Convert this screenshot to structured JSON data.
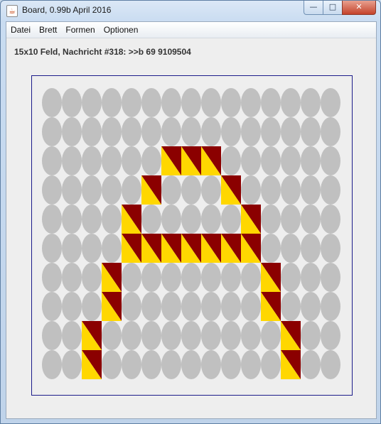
{
  "window": {
    "title": "Board, 0.99b April 2016",
    "icon": "java-cup-icon",
    "controls": {
      "minimize": "—",
      "maximize": "□",
      "close": "✕"
    }
  },
  "menu": [
    "Datei",
    "Brett",
    "Formen",
    "Optionen"
  ],
  "status_text": "15x10 Feld, Nachricht #318: >>b 69 9109504",
  "board": {
    "cols": 15,
    "rows": 10,
    "empty_color": "#c0c0c0",
    "piece_colors": {
      "dark": "#8b0000",
      "light": "#ffd700"
    },
    "border_color": "#1b1b8a",
    "filled": [
      [
        2,
        6
      ],
      [
        2,
        7
      ],
      [
        2,
        8
      ],
      [
        3,
        5
      ],
      [
        3,
        9
      ],
      [
        4,
        4
      ],
      [
        4,
        10
      ],
      [
        5,
        4
      ],
      [
        5,
        5
      ],
      [
        5,
        6
      ],
      [
        5,
        7
      ],
      [
        5,
        8
      ],
      [
        5,
        9
      ],
      [
        5,
        10
      ],
      [
        6,
        3
      ],
      [
        6,
        11
      ],
      [
        7,
        3
      ],
      [
        7,
        11
      ],
      [
        8,
        2
      ],
      [
        8,
        12
      ],
      [
        9,
        2
      ],
      [
        9,
        12
      ]
    ]
  }
}
